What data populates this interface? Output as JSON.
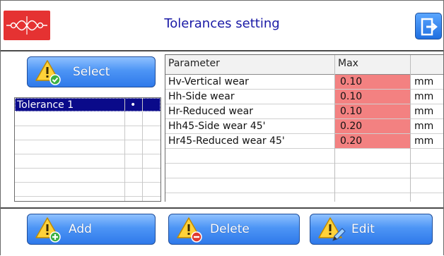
{
  "header": {
    "title": "Tolerances setting",
    "logo_icon": "rail-profile-logo-icon",
    "exit_icon": "exit-icon"
  },
  "select_button": {
    "label": "Select",
    "icon": "warning-check-icon"
  },
  "tolerance_list": {
    "items": [
      {
        "name": "Tolerance 1",
        "marker": "•",
        "selected": true
      }
    ]
  },
  "params_table": {
    "columns": [
      "Parameter",
      "Max",
      ""
    ],
    "rows": [
      {
        "parameter": "Hv-Vertical wear",
        "max": "0.10",
        "unit": "mm"
      },
      {
        "parameter": "Hh-Side wear",
        "max": "0.10",
        "unit": "mm"
      },
      {
        "parameter": "Hr-Reduced wear",
        "max": "0.10",
        "unit": "mm"
      },
      {
        "parameter": "Hh45-Side wear 45'",
        "max": "0.20",
        "unit": "mm"
      },
      {
        "parameter": "Hr45-Reduced wear 45'",
        "max": "0.20",
        "unit": "mm"
      }
    ]
  },
  "footer": {
    "add_label": "Add",
    "delete_label": "Delete",
    "edit_label": "Edit"
  },
  "colors": {
    "accent_blue": "#2f79ea",
    "title_blue": "#1a1aa6",
    "logo_red": "#e53232",
    "max_highlight": "#f38181",
    "selection": "#0a0a8a"
  }
}
